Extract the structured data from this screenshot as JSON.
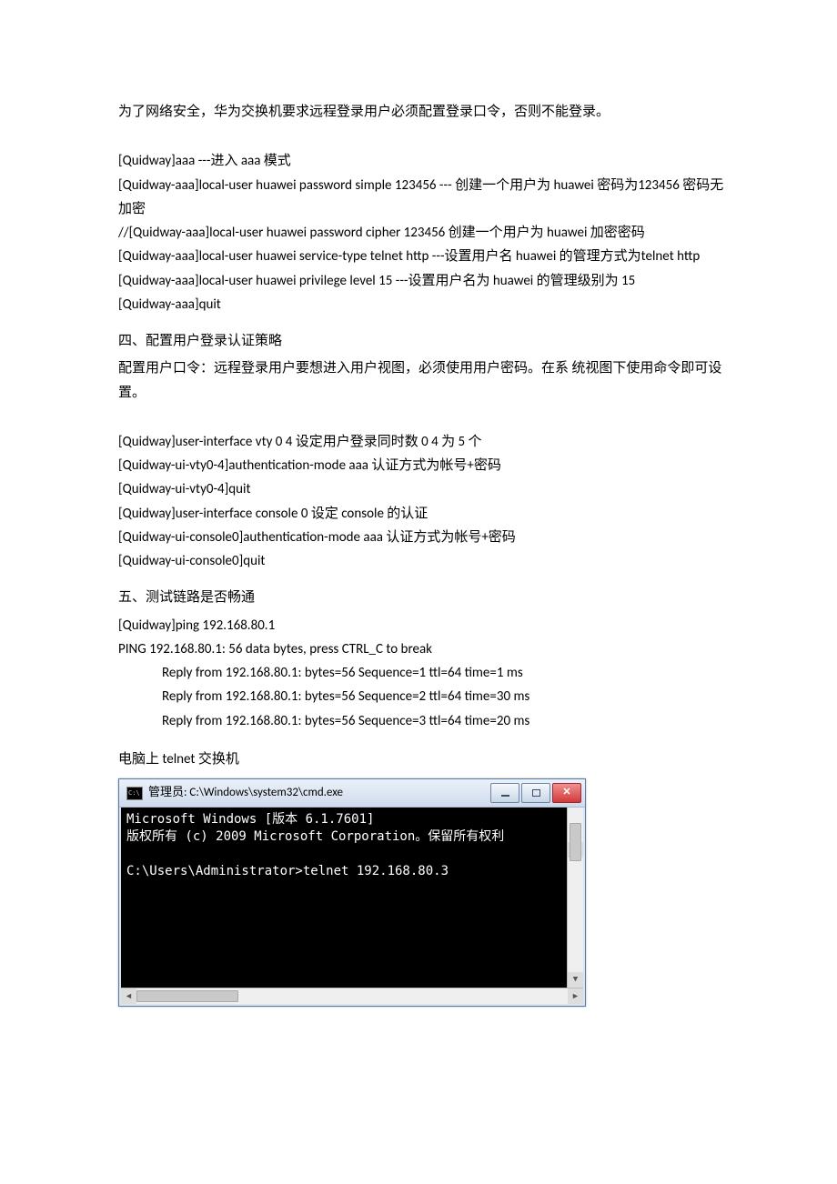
{
  "intro": "为了网络安全，华为交换机要求远程登录用户必须配置登录口令，否则不能登录。",
  "aaa": {
    "l1": "[Quidway]aaa     ---进入 aaa 模式",
    "l2": "[Quidway-aaa]local-user huawei password simple    123456 ---  创建一个用户为 huawei  密码为123456  密码无加密",
    "l3": "//[Quidway-aaa]local-user huawei password cipher    123456  创建一个用户为 huawei  加密密码",
    "l4": "[Quidway-aaa]local-user huawei service-type telnet http    ---设置用户名 huawei  的管理方式为telnet http",
    "l5": "[Quidway-aaa]local-user    huawei privilege level 15    ---设置用户名为 huawei  的管理级别为 15",
    "l6": "[Quidway-aaa]quit"
  },
  "sec4": {
    "title": "四、配置用户登录认证策略",
    "desc": "配置用户口令：远程登录用户要想进入用户视图，必须使用用户密码。在系  统视图下使用命令即可设置。",
    "l1": "[Quidway]user-interface vty 0 4    设定用户登录同时数    0 4  为 5 个",
    "l2": "[Quidway-ui-vty0-4]authentication-mode aaa    认证方式为帐号+密码",
    "l3": "[Quidway-ui-vty0-4]quit",
    "l4": "[Quidway]user-interface console 0  设定 console 的认证",
    "l5": "[Quidway-ui-console0]authentication-mode aaa  认证方式为帐号+密码",
    "l6": "[Quidway-ui-console0]quit"
  },
  "sec5": {
    "title": "五、测试链路是否畅通",
    "l1": "[Quidway]ping 192.168.80.1",
    "l2": "PING 192.168.80.1: 56    data bytes, press CTRL_C to break",
    "r1": "Reply from 192.168.80.1: bytes=56 Sequence=1 ttl=64 time=1 ms",
    "r2": "Reply from 192.168.80.1: bytes=56 Sequence=2 ttl=64 time=30 ms",
    "r3": "Reply from 192.168.80.1: bytes=56 Sequence=3 ttl=64 time=20 ms"
  },
  "telnet_caption": "电脑上 telnet 交换机",
  "cmd": {
    "title": "管理员: C:\\Windows\\system32\\cmd.exe",
    "body": "Microsoft Windows [版本 6.1.7601]\n版权所有 (c) 2009 Microsoft Corporation。保留所有权利\n\nC:\\Users\\Administrator>telnet 192.168.80.3\n"
  }
}
